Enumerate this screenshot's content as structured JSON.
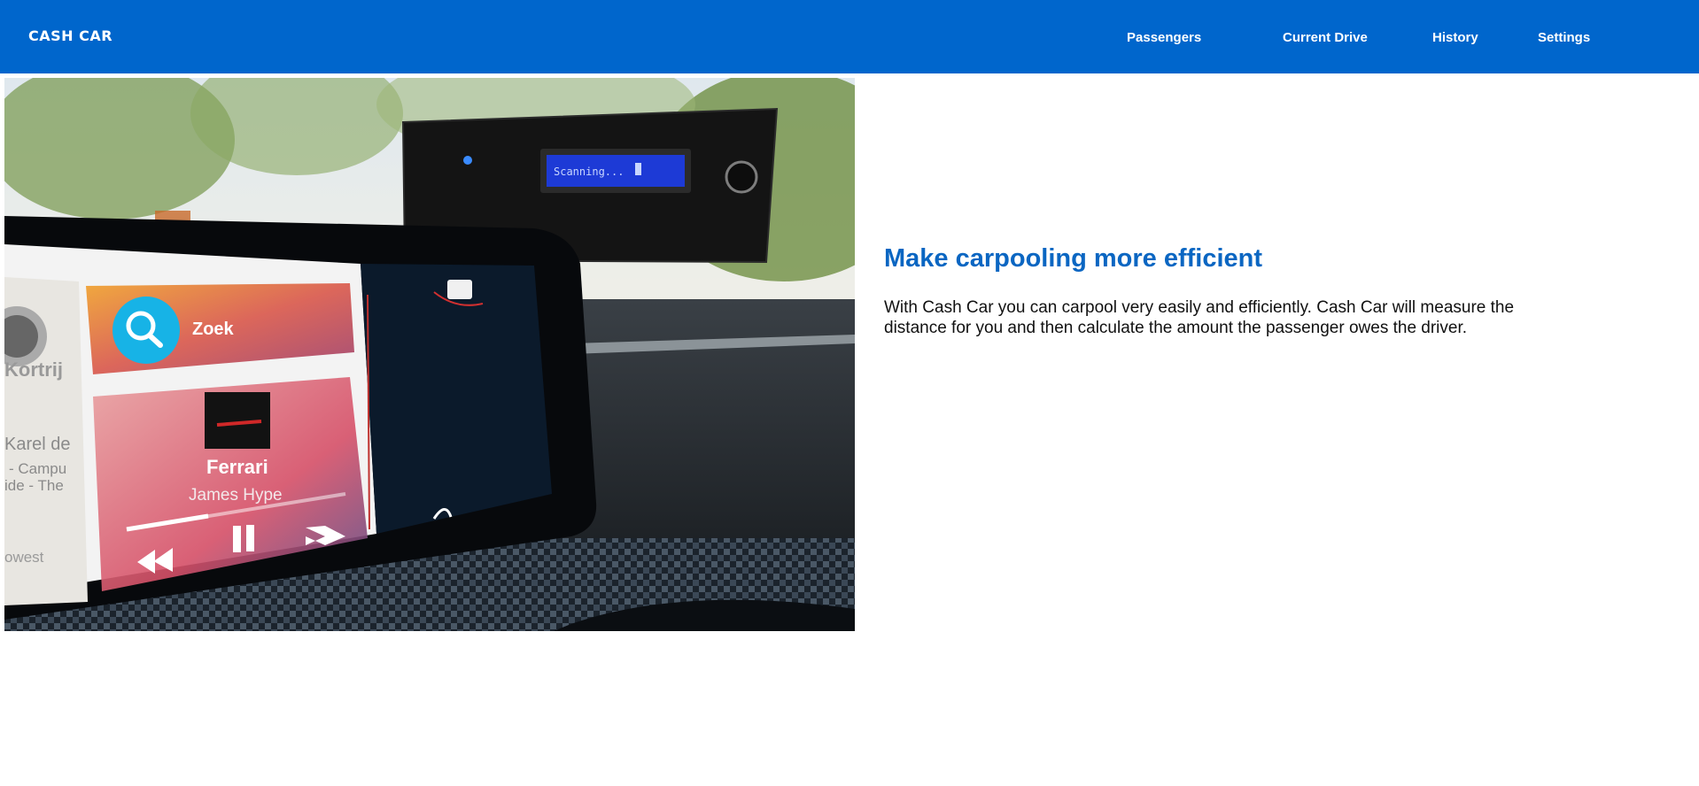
{
  "header": {
    "brand": "CASH CAR",
    "nav": [
      {
        "label": "Passengers"
      },
      {
        "label": "Current Drive"
      },
      {
        "label": "History"
      },
      {
        "label": "Settings"
      }
    ]
  },
  "photo": {
    "lcd_text": "Scanning...",
    "search_label": "Zoek",
    "track_title": "Ferrari",
    "track_artist": "James Hype",
    "map_fragments": [
      "Kortrij",
      "Karel de",
      "- Campu",
      "ide - The",
      "owest"
    ]
  },
  "main": {
    "headline": "Make carpooling more efficient",
    "body": "With Cash Car you can carpool very easily and efficiently. Cash Car will measure the distance for you and then calculate the amount the passenger owes the driver."
  },
  "colors": {
    "brand_blue": "#0066cc",
    "headline_blue": "#0a66c2"
  }
}
